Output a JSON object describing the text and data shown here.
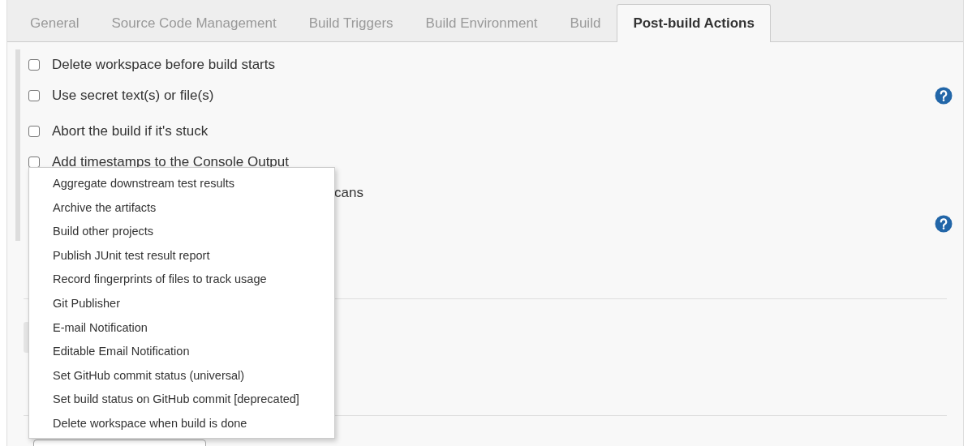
{
  "tabs": [
    {
      "label": "General",
      "selected": false
    },
    {
      "label": "Source Code Management",
      "selected": false
    },
    {
      "label": "Build Triggers",
      "selected": false
    },
    {
      "label": "Build Environment",
      "selected": false
    },
    {
      "label": "Build",
      "selected": false
    },
    {
      "label": "Post-build Actions",
      "selected": true
    }
  ],
  "options": [
    {
      "kind": "checkbox",
      "label": "Delete workspace before build starts",
      "checked": false,
      "help": false
    },
    {
      "kind": "checkbox",
      "label": "Use secret text(s) or file(s)",
      "checked": false,
      "help": true
    },
    {
      "kind": "checkbox",
      "label": "Abort the build if it's stuck",
      "checked": false,
      "help": false
    },
    {
      "kind": "checkbox",
      "label": "Add timestamps to the Console Output",
      "checked": false,
      "help": false
    },
    {
      "kind": "fragment",
      "label": "cans",
      "help": false
    },
    {
      "kind": "blank",
      "help": true
    }
  ],
  "menu": {
    "items": [
      "Aggregate downstream test results",
      "Archive the artifacts",
      "Build other projects",
      "Publish JUnit test result report",
      "Record fingerprints of files to track usage",
      "Git Publisher",
      "E-mail Notification",
      "Editable Email Notification",
      "Set GitHub commit status (universal)",
      "Set build status on GitHub commit [deprecated]",
      "Delete workspace when build is done"
    ]
  }
}
